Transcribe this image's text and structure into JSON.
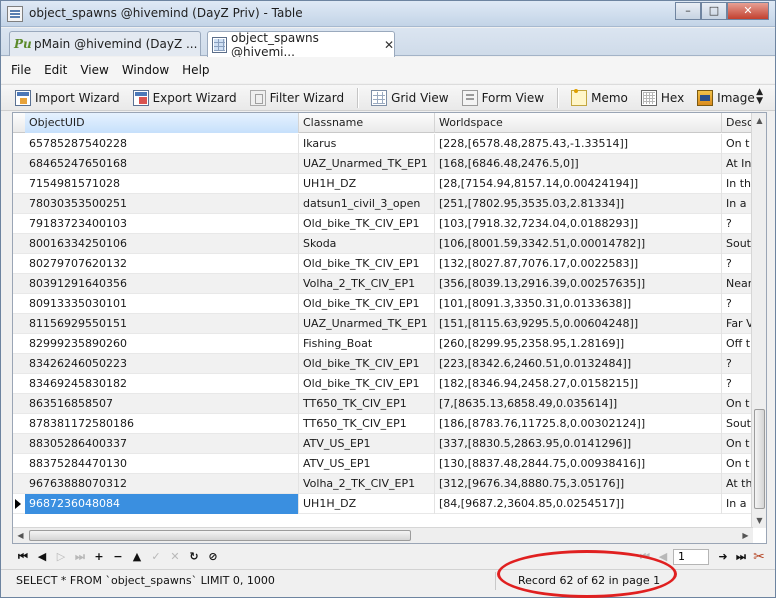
{
  "window": {
    "title": "object_spawns @hivemind (DayZ Priv) - Table",
    "minimize": "–",
    "maximize": "□",
    "close": "✕"
  },
  "tabs": [
    {
      "label": "pMain @hivemind (DayZ ...",
      "icon": "pu-icon"
    },
    {
      "label": "object_spawns @hivemi...",
      "icon": "table-icon",
      "close": "✕"
    }
  ],
  "menu": [
    "File",
    "Edit",
    "View",
    "Window",
    "Help"
  ],
  "toolbar": {
    "import": "Import Wizard",
    "export": "Export Wizard",
    "filter": "Filter Wizard",
    "grid": "Grid View",
    "form": "Form View",
    "memo": "Memo",
    "hex": "Hex",
    "image": "Image"
  },
  "grid": {
    "columns": [
      "ObjectUID",
      "Classname",
      "Worldspace",
      "Desc"
    ],
    "rows": [
      [
        "65785287540228",
        "Ikarus",
        "[228,[6578.48,2875.43,-1.33514]]",
        "On t"
      ],
      [
        "68465247650168",
        "UAZ_Unarmed_TK_EP1",
        "[168,[6846.48,2476.5,0]]",
        "At In"
      ],
      [
        "7154981571028",
        "UH1H_DZ",
        "[28,[7154.94,8157.14,0.00424194]]",
        "In th"
      ],
      [
        "78030353500251",
        "datsun1_civil_3_open",
        "[251,[7802.95,3535.03,2.81334]]",
        "In a"
      ],
      [
        "79183723400103",
        "Old_bike_TK_CIV_EP1",
        "[103,[7918.32,7234.04,0.0188293]]",
        "?"
      ],
      [
        "80016334250106",
        "Skoda",
        "[106,[8001.59,3342.51,0.00014782]]",
        "Sout"
      ],
      [
        "80279707620132",
        "Old_bike_TK_CIV_EP1",
        "[132,[8027.87,7076.17,0.0022583]]",
        "?"
      ],
      [
        "80391291640356",
        "Volha_2_TK_CIV_EP1",
        "[356,[8039.13,2916.39,0.00257635]]",
        "Near"
      ],
      [
        "80913335030101",
        "Old_bike_TK_CIV_EP1",
        "[101,[8091.3,3350.31,0.0133638]]",
        "?"
      ],
      [
        "81156929550151",
        "UAZ_Unarmed_TK_EP1",
        "[151,[8115.63,9295.5,0.00604248]]",
        "Far V"
      ],
      [
        "82999235890260",
        "Fishing_Boat",
        "[260,[8299.95,2358.95,1.28169]]",
        "Off t"
      ],
      [
        "83426246050223",
        "Old_bike_TK_CIV_EP1",
        "[223,[8342.6,2460.51,0.0132484]]",
        "?"
      ],
      [
        "83469245830182",
        "Old_bike_TK_CIV_EP1",
        "[182,[8346.94,2458.27,0.0158215]]",
        "?"
      ],
      [
        "863516858507",
        "TT650_TK_CIV_EP1",
        "[7,[8635.13,6858.49,0.035614]]",
        "On t"
      ],
      [
        "878381172580186",
        "TT650_TK_CIV_EP1",
        "[186,[8783.76,11725.8,0.00302124]]",
        "Sout"
      ],
      [
        "88305286400337",
        "ATV_US_EP1",
        "[337,[8830.5,2863.95,0.0141296]]",
        "On t"
      ],
      [
        "88375284470130",
        "ATV_US_EP1",
        "[130,[8837.48,2844.75,0.00938416]]",
        "On t"
      ],
      [
        "96763888070312",
        "Volha_2_TK_CIV_EP1",
        "[312,[9676.34,8880.75,3.05176]]",
        "At th"
      ],
      [
        "9687236048084",
        "UH1H_DZ",
        "[84,[9687.2,3604.85,0.0254517]]",
        "In a"
      ]
    ],
    "selected_row": 18
  },
  "nav": {
    "page": "1"
  },
  "status": {
    "sql": "SELECT * FROM `object_spawns` LIMIT 0, 1000",
    "record": "Record 62 of 62 in page 1"
  },
  "colors": {
    "selection": "#3a8fe0",
    "annotation": "#e02020"
  }
}
